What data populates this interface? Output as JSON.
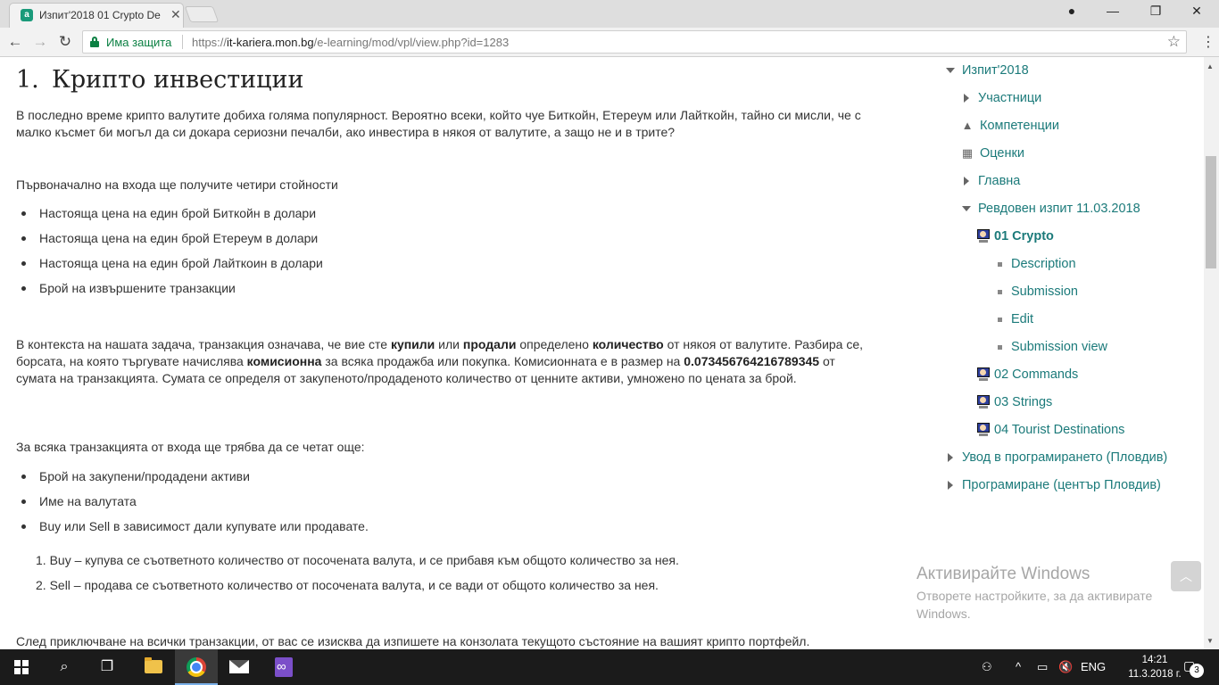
{
  "browser": {
    "tab_title": "Изпит'2018 01 Crypto Dе",
    "tab_favicon": "a",
    "close_glyph": "✕",
    "minimize_glyph": "—",
    "maximize_glyph": "❐",
    "window_close_glyph": "✕",
    "back_glyph": "←",
    "forward_glyph": "→",
    "reload_glyph": "↻",
    "secure_label": "Има защита",
    "url_prefix": "https://",
    "url_host": "it-kariera.mon.bg",
    "url_path": "/e-learning/mod/vpl/view.php?id=1283",
    "star_glyph": "☆",
    "menu_glyph": "⋮"
  },
  "article": {
    "number": "1.",
    "title": "Крипто инвестиции",
    "intro": "В последно време крипто валутите добиха голяма популярност. Вероятно всеки, който чуе Биткойн, Етереум или Лайткойн, тайно си мисли, че с малко късмет би могъл да си докара сериозни печалби, ако инвестира в някоя от валутите, а защо не и в трите?",
    "input_intro": "Първоначално на входа ще получите четири стойности",
    "input_items": [
      "Настояща цена на един брой Биткойн в долари",
      "Настояща цена на един брой Етереум в долари",
      "Настояща цена на един брой Лайткоин в долари",
      "Брой на извършените транзакции"
    ],
    "context_p1": "В контекста на нашата задача, транзакция означава, че вие сте ",
    "context_b1": "купили",
    "context_p2": " или ",
    "context_b2": "продали",
    "context_p3": " определено ",
    "context_b3": "количество",
    "context_p4": " от някоя от валутите. Разбира се, борсата, на която търгувате начислява ",
    "context_b4": "комисионна",
    "context_p5": " за всяка продажба или покупка. Комисионната е в размер на ",
    "context_b5": "0.073456764216789345",
    "context_p6": " от сумата на транзакцията. Сумата се определя от закупеното/продаденото количество от ценните активи, умножено по цената за брой.",
    "per_tx_intro": "За всяка транзакцията от входа ще трябва да се четат още:",
    "per_tx_items": [
      "Брой на закупени/продадени активи",
      "Име на валутата",
      "Buy или Sell в зависимост дали купувате или продавате."
    ],
    "ordered_items": [
      "1. Buy – купува се съответното количество от посочената валута, и се прибавя към общото количество за нея.",
      "2. Sell – продава се съответното количество от посочената валута, и се вади от общото количество за нея."
    ],
    "outro": "След приключване на всички транзакции, от вас се изисква да изпишете на конзолата текущото състояние на вашият крипто портфейл."
  },
  "sidenav": {
    "root": "Изпит'2018",
    "participants": "Участници",
    "competencies": "Компетенции",
    "grades": "Оценки",
    "main": "Главна",
    "exam": "Ревдовен изпит 11.03.2018",
    "current": "01 Crypto",
    "sub_items": [
      "Description",
      "Submission",
      "Edit",
      "Submission view"
    ],
    "tasks": [
      "02 Commands",
      "03 Strings",
      "04 Tourist Destinations"
    ],
    "courses": [
      "Увод в програмирането (Пловдив)",
      "Програмиране (център Пловдив)"
    ]
  },
  "watermark": {
    "title": "Активирайте Windows",
    "line1": "Отворете настройките, за да активирате",
    "line2": "Windows."
  },
  "taskbar": {
    "language": "ENG",
    "time": "14:21",
    "date": "11.3.2018 г.",
    "notification_count": "3"
  },
  "colors": {
    "link": "#1b7a7a",
    "secure": "#0b8043",
    "taskbar": "#1b1b1b"
  }
}
